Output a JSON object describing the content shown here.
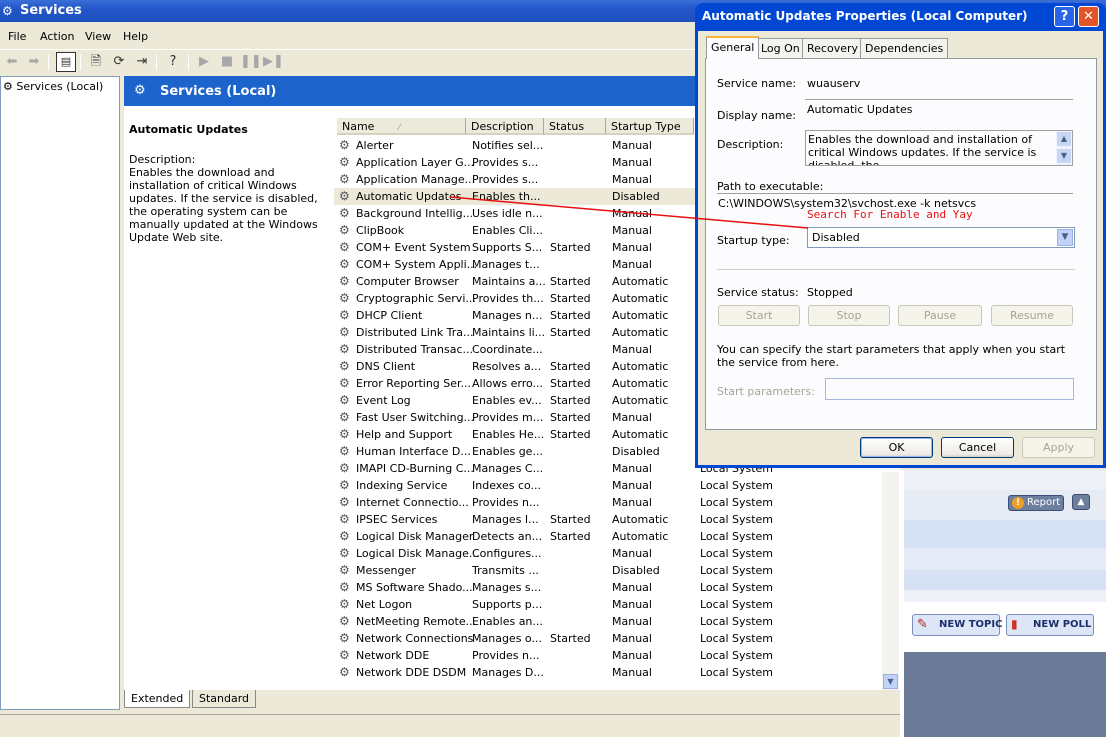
{
  "services_window": {
    "title": "Services",
    "menu": [
      "File",
      "Action",
      "View",
      "Help"
    ],
    "tree_node": "Services (Local)",
    "banner_title": "Services (Local)",
    "description_pane": {
      "service_title": "Automatic Updates",
      "description_label": "Description:",
      "description_text": "Enables the download and installation of critical Windows updates. If the service is disabled, the operating system can be manually updated at the Windows Update Web site."
    },
    "columns": [
      "Name",
      "Description",
      "Status",
      "Startup Type"
    ],
    "services": [
      {
        "name": "Alerter",
        "desc": "Notifies sel...",
        "status": "",
        "startup": "Manual",
        "logon": ""
      },
      {
        "name": "Application Layer G...",
        "desc": "Provides s...",
        "status": "",
        "startup": "Manual",
        "logon": ""
      },
      {
        "name": "Application Manage...",
        "desc": "Provides s...",
        "status": "",
        "startup": "Manual",
        "logon": ""
      },
      {
        "name": "Automatic Updates",
        "desc": "Enables th...",
        "status": "",
        "startup": "Disabled",
        "logon": ""
      },
      {
        "name": "Background Intellig...",
        "desc": "Uses idle n...",
        "status": "",
        "startup": "Manual",
        "logon": ""
      },
      {
        "name": "ClipBook",
        "desc": "Enables Cli...",
        "status": "",
        "startup": "Manual",
        "logon": ""
      },
      {
        "name": "COM+ Event System",
        "desc": "Supports S...",
        "status": "Started",
        "startup": "Manual",
        "logon": ""
      },
      {
        "name": "COM+ System Appli...",
        "desc": "Manages t...",
        "status": "",
        "startup": "Manual",
        "logon": ""
      },
      {
        "name": "Computer Browser",
        "desc": "Maintains a...",
        "status": "Started",
        "startup": "Automatic",
        "logon": ""
      },
      {
        "name": "Cryptographic Servi...",
        "desc": "Provides th...",
        "status": "Started",
        "startup": "Automatic",
        "logon": ""
      },
      {
        "name": "DHCP Client",
        "desc": "Manages n...",
        "status": "Started",
        "startup": "Automatic",
        "logon": ""
      },
      {
        "name": "Distributed Link Tra...",
        "desc": "Maintains li...",
        "status": "Started",
        "startup": "Automatic",
        "logon": ""
      },
      {
        "name": "Distributed Transac...",
        "desc": "Coordinate...",
        "status": "",
        "startup": "Manual",
        "logon": ""
      },
      {
        "name": "DNS Client",
        "desc": "Resolves a...",
        "status": "Started",
        "startup": "Automatic",
        "logon": ""
      },
      {
        "name": "Error Reporting Ser...",
        "desc": "Allows erro...",
        "status": "Started",
        "startup": "Automatic",
        "logon": ""
      },
      {
        "name": "Event Log",
        "desc": "Enables ev...",
        "status": "Started",
        "startup": "Automatic",
        "logon": ""
      },
      {
        "name": "Fast User Switching...",
        "desc": "Provides m...",
        "status": "Started",
        "startup": "Manual",
        "logon": ""
      },
      {
        "name": "Help and Support",
        "desc": "Enables He...",
        "status": "Started",
        "startup": "Automatic",
        "logon": ""
      },
      {
        "name": "Human Interface D...",
        "desc": "Enables ge...",
        "status": "",
        "startup": "Disabled",
        "logon": ""
      },
      {
        "name": "IMAPI CD-Burning C...",
        "desc": "Manages C...",
        "status": "",
        "startup": "Manual",
        "logon": "Local System"
      },
      {
        "name": "Indexing Service",
        "desc": "Indexes co...",
        "status": "",
        "startup": "Manual",
        "logon": "Local System"
      },
      {
        "name": "Internet Connectio...",
        "desc": "Provides n...",
        "status": "",
        "startup": "Manual",
        "logon": "Local System"
      },
      {
        "name": "IPSEC Services",
        "desc": "Manages I...",
        "status": "Started",
        "startup": "Automatic",
        "logon": "Local System"
      },
      {
        "name": "Logical Disk Manager",
        "desc": "Detects an...",
        "status": "Started",
        "startup": "Automatic",
        "logon": "Local System"
      },
      {
        "name": "Logical Disk Manage...",
        "desc": "Configures...",
        "status": "",
        "startup": "Manual",
        "logon": "Local System"
      },
      {
        "name": "Messenger",
        "desc": "Transmits ...",
        "status": "",
        "startup": "Disabled",
        "logon": "Local System"
      },
      {
        "name": "MS Software Shado...",
        "desc": "Manages s...",
        "status": "",
        "startup": "Manual",
        "logon": "Local System"
      },
      {
        "name": "Net Logon",
        "desc": "Supports p...",
        "status": "",
        "startup": "Manual",
        "logon": "Local System"
      },
      {
        "name": "NetMeeting Remote...",
        "desc": "Enables an...",
        "status": "",
        "startup": "Manual",
        "logon": "Local System"
      },
      {
        "name": "Network Connections",
        "desc": "Manages o...",
        "status": "Started",
        "startup": "Manual",
        "logon": "Local System"
      },
      {
        "name": "Network DDE",
        "desc": "Provides n...",
        "status": "",
        "startup": "Manual",
        "logon": "Local System"
      },
      {
        "name": "Network DDE DSDM",
        "desc": "Manages D...",
        "status": "",
        "startup": "Manual",
        "logon": "Local System"
      }
    ],
    "bottom_tabs": [
      "Extended",
      "Standard"
    ]
  },
  "dialog": {
    "title": "Automatic Updates Properties (Local Computer)",
    "tabs": [
      "General",
      "Log On",
      "Recovery",
      "Dependencies"
    ],
    "service_name_label": "Service name:",
    "service_name": "wuauserv",
    "display_name_label": "Display name:",
    "display_name": "Automatic Updates",
    "description_label": "Description:",
    "description": "Enables the download and installation of critical Windows updates. If the service is disabled, the",
    "path_label": "Path to executable:",
    "path": "C:\\WINDOWS\\system32\\svchost.exe -k netsvcs",
    "startup_type_label": "Startup type:",
    "startup_type": "Disabled",
    "service_status_label": "Service status:",
    "service_status": "Stopped",
    "buttons": {
      "start": "Start",
      "stop": "Stop",
      "pause": "Pause",
      "resume": "Resume"
    },
    "hint": "You can specify the start parameters that apply when you start the service from here.",
    "start_params_label": "Start parameters:",
    "ok": "OK",
    "cancel": "Cancel",
    "apply": "Apply"
  },
  "annotation": {
    "text": "Search For Enable and Yay",
    "color": "#e81010"
  },
  "forum": {
    "report": "Report",
    "new_topic": "NEW TOPIC",
    "new_poll": "NEW POLL"
  }
}
